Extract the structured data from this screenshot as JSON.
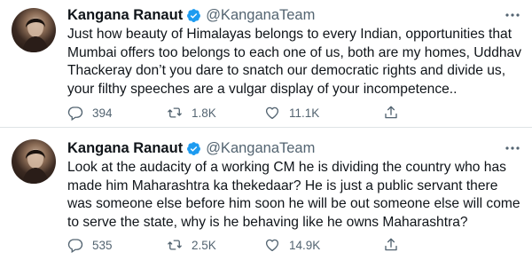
{
  "colors": {
    "verified_badge": "#1d9bf0",
    "secondary_text": "#536471",
    "primary_text": "#0f1419",
    "divider": "#dfe3e6"
  },
  "tweets": [
    {
      "author_name": "Kangana Ranaut",
      "handle": "@KanganaTeam",
      "text": "Just how beauty of Himalayas belongs to every Indian, opportunities that Mumbai offers too belongs to each one of us, both are my homes, Uddhav Thackeray don’t you dare to snatch our democratic rights and divide us, your filthy speeches are a vulgar display of your incompetence..",
      "replies": "394",
      "retweets": "1.8K",
      "likes": "11.1K",
      "icons": {
        "reply": "reply-icon",
        "retweet": "retweet-icon",
        "like": "like-icon",
        "share": "share-icon",
        "more": "more-icon",
        "verified": "verified-icon"
      }
    },
    {
      "author_name": "Kangana Ranaut",
      "handle": "@KanganaTeam",
      "text": "Look at the audacity of a working CM he is dividing the country who has made him Maharashtra ka thekedaar? He is just a public servant there was someone else before him soon he will be out someone else will come to serve the state, why is he behaving like he owns Maharashtra?",
      "replies": "535",
      "retweets": "2.5K",
      "likes": "14.9K",
      "icons": {
        "reply": "reply-icon",
        "retweet": "retweet-icon",
        "like": "like-icon",
        "share": "share-icon",
        "more": "more-icon",
        "verified": "verified-icon"
      }
    }
  ]
}
